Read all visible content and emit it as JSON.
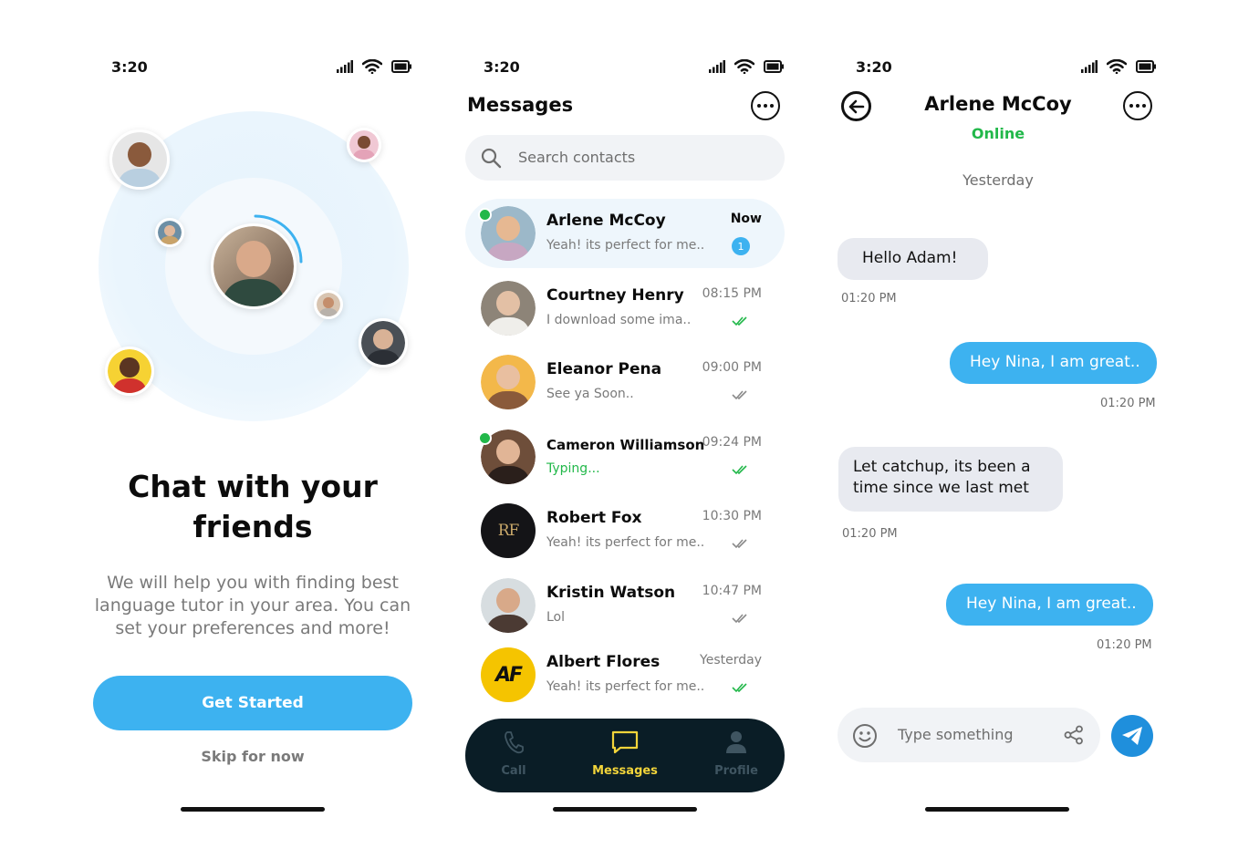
{
  "status_bar": {
    "time": "3:20"
  },
  "onboarding": {
    "title": "Chat with your friends",
    "subtitle": "We will help you with finding best language tutor in your area. You can set your preferences and more!",
    "primary_button": "Get Started",
    "secondary_button": "Skip for now"
  },
  "messages": {
    "title": "Messages",
    "search_placeholder": "Search contacts",
    "chats": [
      {
        "name": "Arlene McCoy",
        "preview": "Yeah! its perfect for me..",
        "time": "Now",
        "unread": "1",
        "online": true
      },
      {
        "name": "Courtney Henry",
        "preview": "I download some ima..",
        "time": "08:15 PM",
        "read": true
      },
      {
        "name": "Eleanor Pena",
        "preview": "See ya Soon..",
        "time": "09:00 PM",
        "read": false
      },
      {
        "name": "Cameron Williamson",
        "preview": "Typing...",
        "time": "09:24 PM",
        "read": true,
        "online": true
      },
      {
        "name": "Robert Fox",
        "preview": "Yeah! its perfect for me..",
        "time": "10:30 PM",
        "read": false,
        "avatar_text": "RF"
      },
      {
        "name": "Kristin Watson",
        "preview": "Lol",
        "time": "10:47 PM",
        "read": false
      },
      {
        "name": "Albert Flores",
        "preview": "Yeah! its perfect for me..",
        "time": "Yesterday",
        "read": true,
        "avatar_text": "AF"
      }
    ],
    "tabs": [
      {
        "label": "Call",
        "icon": "phone-icon"
      },
      {
        "label": "Messages",
        "icon": "chat-icon",
        "active": true
      },
      {
        "label": "Profile",
        "icon": "person-icon"
      }
    ]
  },
  "conversation": {
    "contact_name": "Arlene McCoy",
    "status": "Online",
    "day": "Yesterday",
    "messages": [
      {
        "direction": "in",
        "text": "Hello Adam!",
        "time": "01:20 PM"
      },
      {
        "direction": "out",
        "text": "Hey Nina, I am great..",
        "time": "01:20 PM"
      },
      {
        "direction": "in",
        "text": "Let catchup, its been a time since we last met",
        "time": "01:20 PM"
      },
      {
        "direction": "out",
        "text": "Hey Nina, I am great..",
        "time": "01:20 PM"
      }
    ],
    "composer_placeholder": "Type something"
  },
  "colors": {
    "accent": "#3db2f0",
    "online": "#22b84a",
    "tabbar": "#0a1d26",
    "tab_active": "#f2d43a"
  }
}
